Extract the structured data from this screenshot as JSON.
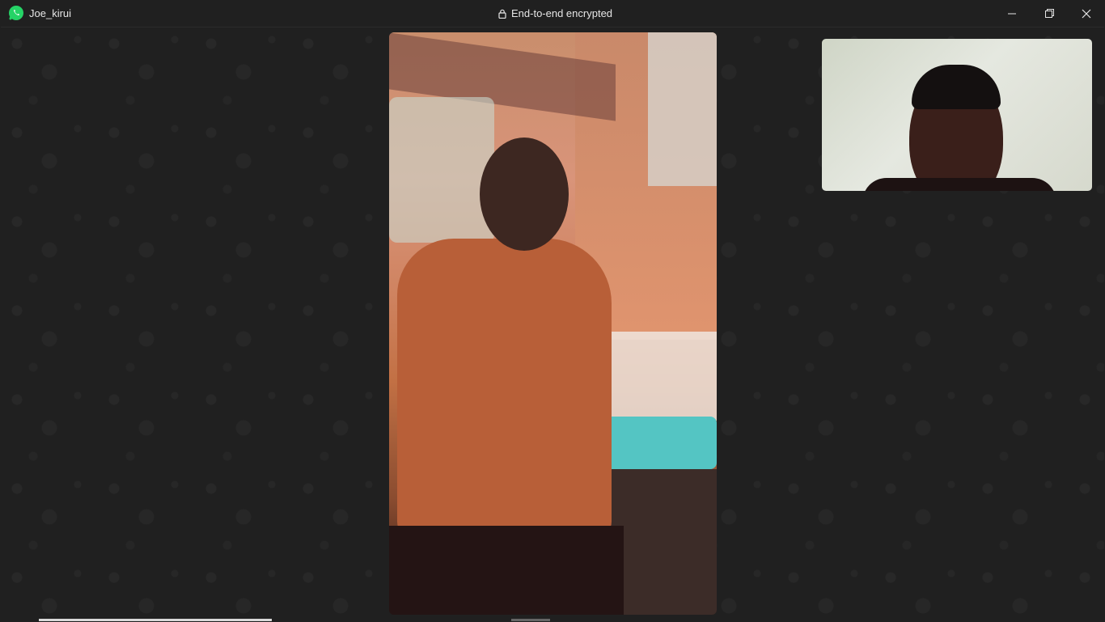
{
  "window": {
    "title": "Joe_kirui",
    "status": "End-to-end encrypted",
    "app_icon": "whatsapp-icon",
    "controls": {
      "minimize_icon": "minimize-icon",
      "maximize_icon": "restore-icon",
      "close_icon": "close-icon"
    }
  },
  "call": {
    "remote_video_label": "remote-video-feed",
    "self_video_label": "self-video-preview"
  },
  "colors": {
    "titlebar_bg": "#202020",
    "background": "#202020",
    "accent_green": "#25D366"
  }
}
